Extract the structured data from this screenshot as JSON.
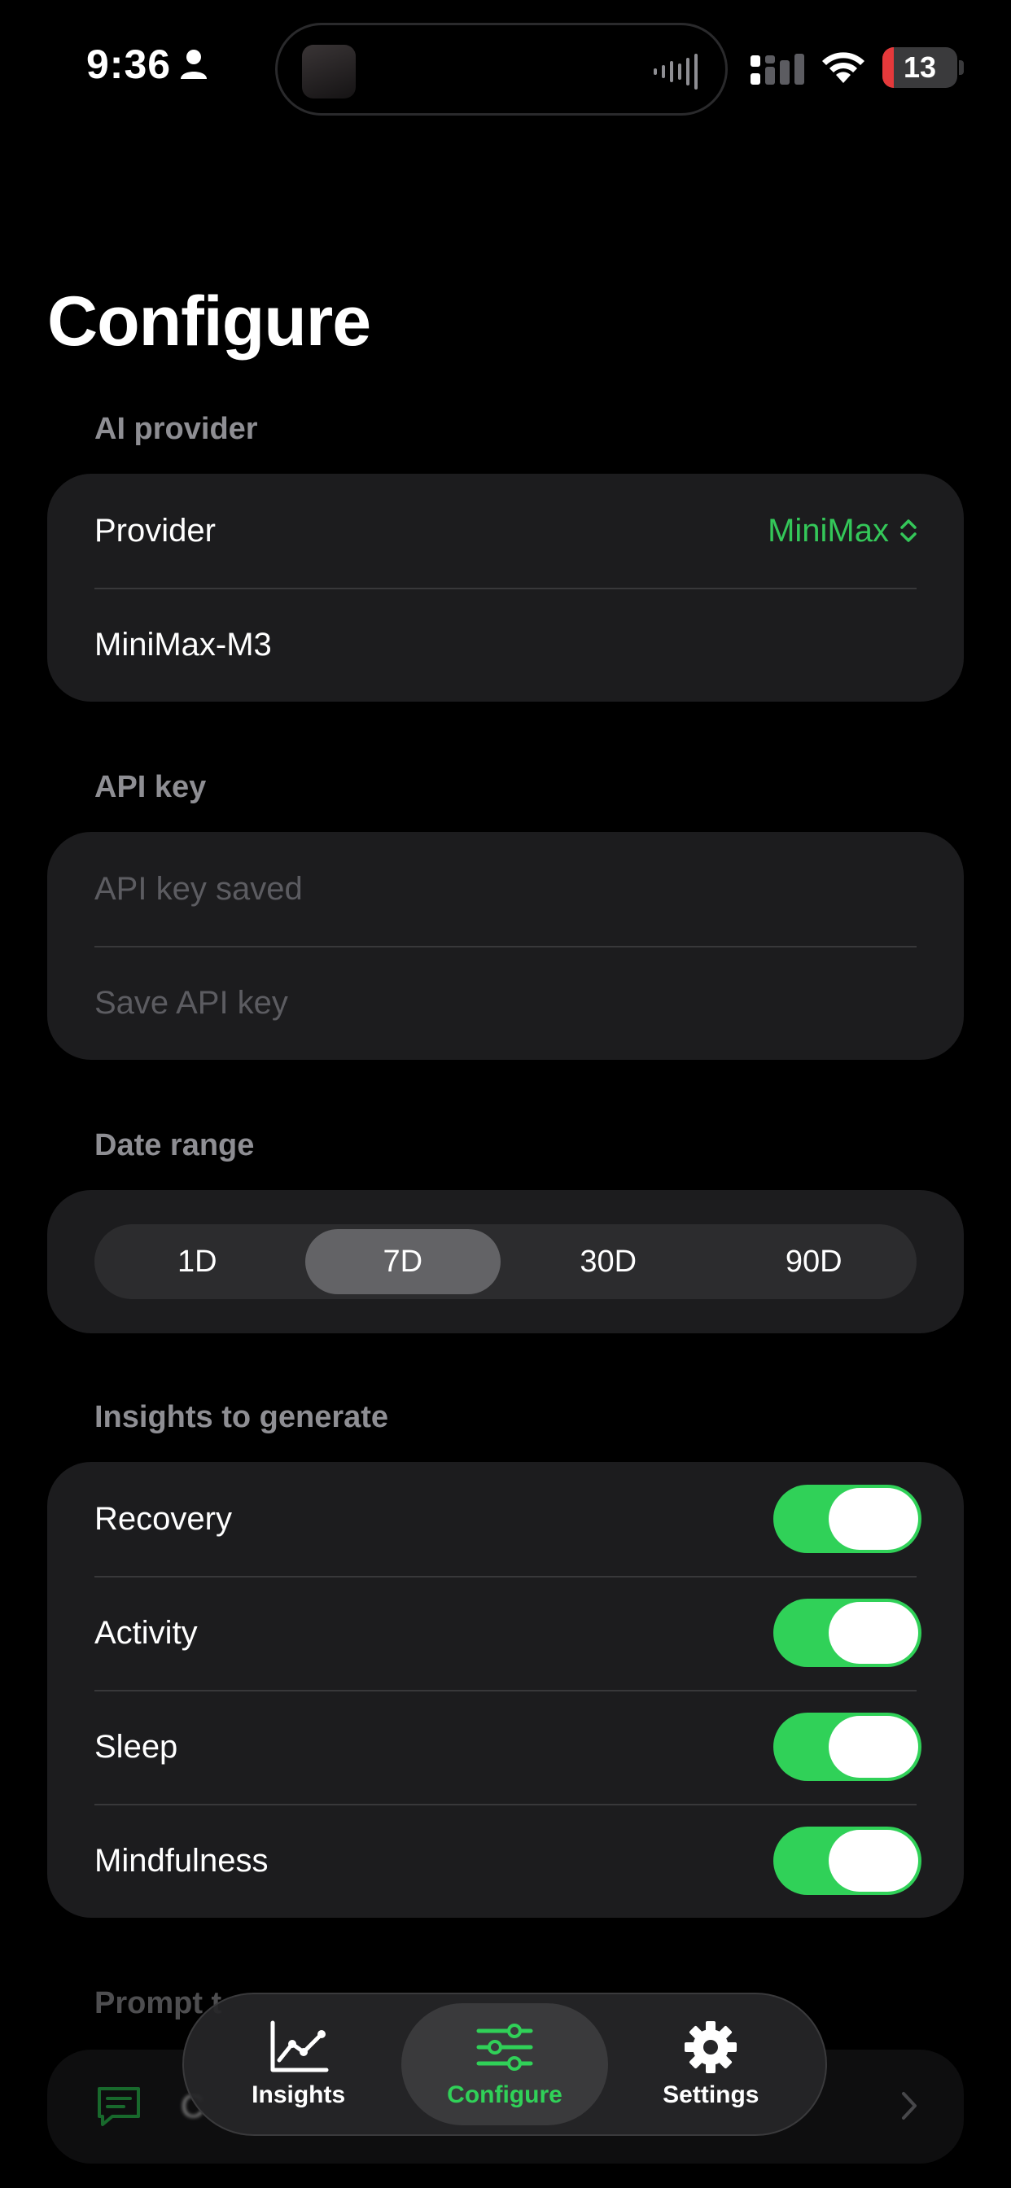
{
  "status_bar": {
    "time": "9:36",
    "battery": "13"
  },
  "page": {
    "title": "Configure"
  },
  "ai_provider": {
    "header": "AI provider",
    "provider_label": "Provider",
    "provider_value": "MiniMax",
    "model": "MiniMax-M3"
  },
  "api_key": {
    "header": "API key",
    "input_placeholder": "API key saved",
    "save_label": "Save API key"
  },
  "date_range": {
    "header": "Date range",
    "options": [
      "1D",
      "7D",
      "30D",
      "90D"
    ],
    "selected": "7D"
  },
  "insights": {
    "header": "Insights to generate",
    "items": [
      {
        "label": "Recovery",
        "enabled": true
      },
      {
        "label": "Activity",
        "enabled": true
      },
      {
        "label": "Sleep",
        "enabled": true
      },
      {
        "label": "Mindfulness",
        "enabled": true
      }
    ]
  },
  "prompt_section": {
    "header": "Prompt t",
    "row_text": "C"
  },
  "tabbar": {
    "tabs": [
      {
        "label": "Insights",
        "icon": "chart-line-icon",
        "active": false
      },
      {
        "label": "Configure",
        "icon": "sliders-icon",
        "active": true
      },
      {
        "label": "Settings",
        "icon": "gear-icon",
        "active": false
      }
    ]
  },
  "colors": {
    "accent": "#30d158",
    "card": "#1c1c1e",
    "background": "#000000",
    "muted": "#8e8e93"
  }
}
